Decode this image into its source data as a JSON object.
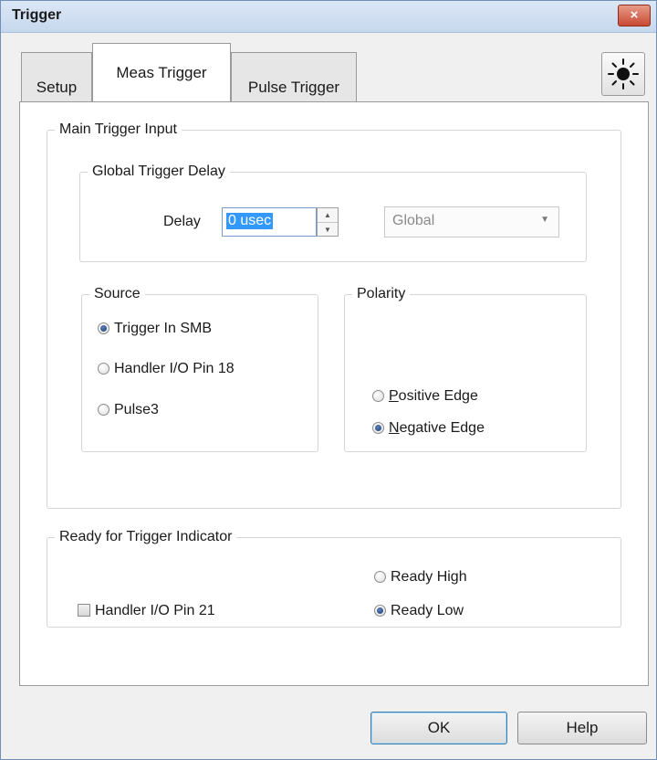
{
  "window": {
    "title": "Trigger",
    "close_icon": "×"
  },
  "tabs": [
    {
      "label": "Setup",
      "active": false
    },
    {
      "label": "Meas Trigger",
      "active": true
    },
    {
      "label": "Pulse Trigger",
      "active": false
    }
  ],
  "toolbar": {
    "sun_icon": "sun-icon"
  },
  "main_trigger_input": {
    "legend": "Main Trigger Input",
    "global_trigger_delay": {
      "legend": "Global Trigger Delay",
      "delay_label": "Delay",
      "delay_value": "0 usec",
      "scope_value": "Global"
    },
    "source": {
      "legend": "Source",
      "options": [
        {
          "label": "Trigger In SMB",
          "checked": true
        },
        {
          "label": "Handler I/O Pin 18",
          "checked": false
        },
        {
          "label": "Pulse3",
          "checked": false
        }
      ]
    },
    "polarity": {
      "legend": "Polarity",
      "positive_accel": "P",
      "positive_rest": "ositive Edge",
      "positive_checked": false,
      "negative_accel": "N",
      "negative_rest": "egative Edge",
      "negative_checked": true
    }
  },
  "ready_indicator": {
    "legend": "Ready for Trigger Indicator",
    "checkbox_label": "Handler I/O Pin 21",
    "checkbox_checked": false,
    "ready_high": "Ready High",
    "ready_high_checked": false,
    "ready_low": "Ready Low",
    "ready_low_checked": true
  },
  "buttons": {
    "ok": "OK",
    "help": "Help"
  }
}
